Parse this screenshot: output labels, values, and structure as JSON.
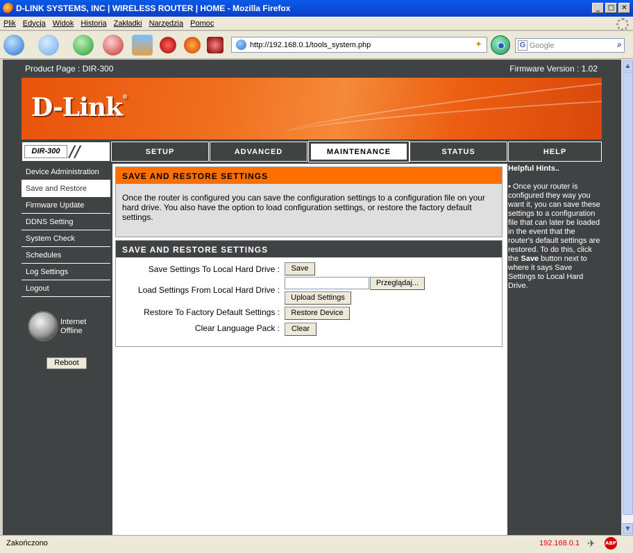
{
  "window": {
    "title": "D-LINK SYSTEMS, INC | WIRELESS ROUTER | HOME - Mozilla Firefox"
  },
  "menu": [
    "Plik",
    "Edycja",
    "Widok",
    "Historia",
    "Zakładki",
    "Narzędzia",
    "Pomoc"
  ],
  "toolbar": {
    "url": "http://192.168.0.1/tools_system.php",
    "search_placeholder": "Google"
  },
  "router": {
    "product_page": "Product Page :  DIR-300",
    "firmware": "Firmware Version : 1.02",
    "logo": "D-Link",
    "model": "DIR-300",
    "tabs": [
      "SETUP",
      "ADVANCED",
      "MAINTENANCE",
      "STATUS",
      "HELP"
    ],
    "active_tab": "MAINTENANCE",
    "sidebar": [
      "Device Administration",
      "Save and Restore",
      "Firmware Update",
      "DDNS Setting",
      "System Check",
      "Schedules",
      "Log Settings",
      "Logout"
    ],
    "internet_status": "Internet",
    "offline": "Offline",
    "reboot": "Reboot",
    "section1": {
      "title": "SAVE AND RESTORE SETTINGS",
      "text": "Once the router is configured you can save the configuration settings to a configuration file on your hard drive. You also have the option to load configuration settings, or restore the factory default settings."
    },
    "section2": {
      "title": "SAVE AND RESTORE SETTINGS",
      "save_label": "Save Settings To Local Hard Drive :",
      "save_btn": "Save",
      "load_label": "Load Settings From Local Hard Drive :",
      "browse_btn": "Przeglądaj...",
      "upload_btn": "Upload Settings",
      "restore_label": "Restore To Factory Default Settings :",
      "restore_btn": "Restore Device",
      "clear_label": "Clear Language Pack :",
      "clear_btn": "Clear"
    },
    "help": {
      "title": "Helpful Hints..",
      "text_pre": "•  Once your router is configured they way you want it, you can save these settings to a configuration file that can later be loaded in the event that the router's default settings are restored. To do this, click the ",
      "text_bold": "Save",
      "text_post": " button next to where it says Save Settings to Local Hard Drive."
    }
  },
  "status": {
    "left": "Zakończono",
    "ip": "192.168.0.1",
    "abp": "ABP"
  }
}
